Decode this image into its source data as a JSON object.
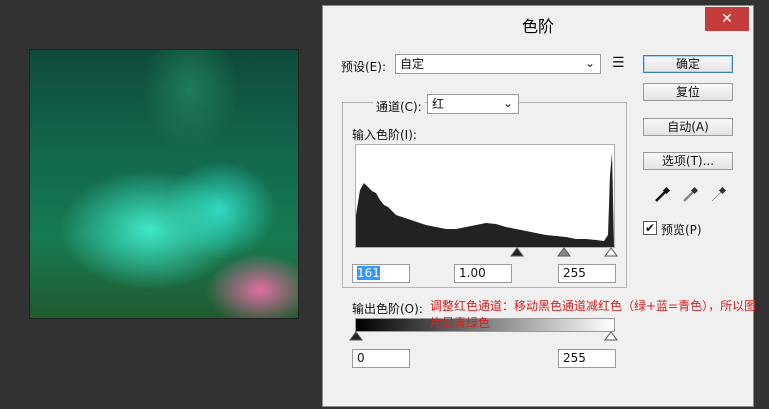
{
  "dialog": {
    "title": "色阶",
    "close_glyph": "✕"
  },
  "preset": {
    "label": "预设(E):",
    "value": "自定"
  },
  "channel": {
    "label": "通道(C):",
    "value": "红"
  },
  "input_levels": {
    "label": "输入色阶(I):",
    "black": "161",
    "gamma": "1.00",
    "white": "255"
  },
  "output_levels": {
    "label": "输出色阶(O):",
    "black": "0",
    "white": "255"
  },
  "buttons": {
    "ok": "确定",
    "reset": "复位",
    "auto": "自动(A)",
    "options": "选项(T)..."
  },
  "preview": {
    "label": "预览(P)",
    "checked": true
  },
  "annotation": "调整红色通道：移动黑色通道减红色（绿+蓝=青色），所以图片显青绿色",
  "icons": [
    "close-icon",
    "chevron-down-icon",
    "preset-menu-icon",
    "black-eyedropper-icon",
    "gray-eyedropper-icon",
    "white-eyedropper-icon",
    "checkmark-icon"
  ]
}
